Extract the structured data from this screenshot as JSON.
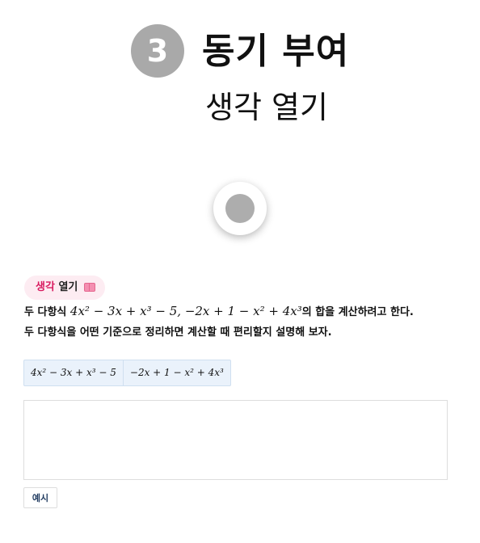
{
  "header": {
    "step_number": "3",
    "section_title": "동기 부여",
    "section_subtitle": "생각 열기"
  },
  "badge": {
    "label_part1": "생각",
    "label_part2": "열기",
    "icon": "open-book-icon"
  },
  "problem": {
    "line1_prefix": "두 다항식 ",
    "expr1": "4x² − 3x + x³ − 5",
    "separator": ", ",
    "expr2": "−2x + 1 − x² + 4x³",
    "line1_suffix": "의 합을 계산하려고 한다.",
    "line2": "두 다항식을 어떤 기준으로 정리하면 계산할 때 편리할지 설명해 보자."
  },
  "chips": [
    "4x² − 3x + x³ − 5",
    "−2x + 1 − x² + 4x³"
  ],
  "answer": {
    "value": ""
  },
  "example_button": {
    "label": "예시"
  },
  "colors": {
    "step_circle": "#a9a9a9",
    "badge_background": "#fdecf2",
    "badge_accent": "#d81b60",
    "chip_background": "#eaf2fb",
    "button_text": "#1f3a5f"
  }
}
